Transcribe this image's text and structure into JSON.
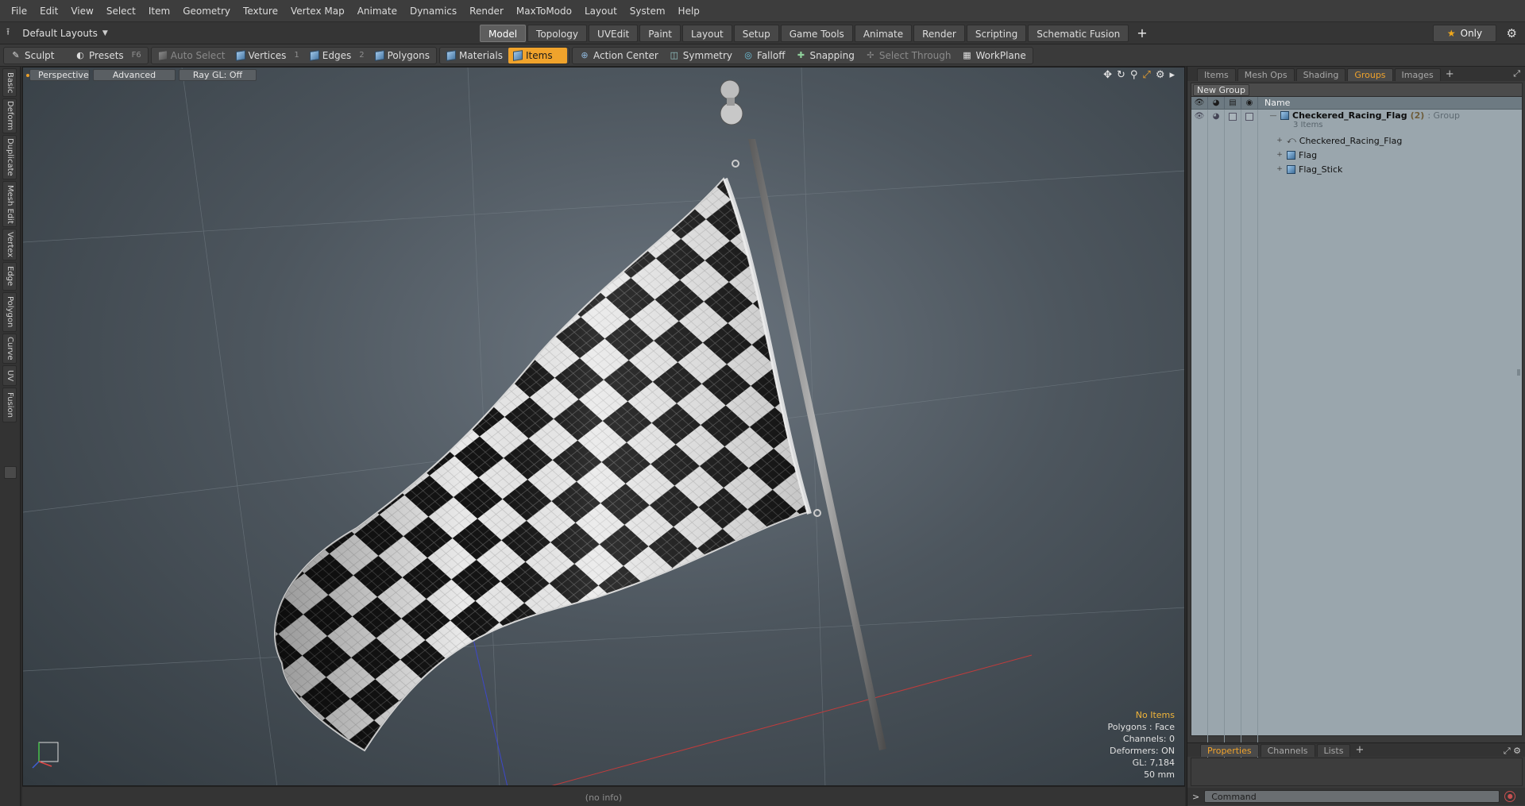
{
  "menubar": {
    "items": [
      "File",
      "Edit",
      "View",
      "Select",
      "Item",
      "Geometry",
      "Texture",
      "Vertex Map",
      "Animate",
      "Dynamics",
      "Render",
      "MaxToModo",
      "Layout",
      "System",
      "Help"
    ]
  },
  "tabbar": {
    "layout_selector": "Default Layouts",
    "tabs": [
      "Model",
      "Topology",
      "UVEdit",
      "Paint",
      "Layout",
      "Setup",
      "Game Tools",
      "Animate",
      "Render",
      "Scripting",
      "Schematic Fusion"
    ],
    "active_tab": "Model",
    "add_tab": "+",
    "only_label": "Only"
  },
  "toolbar": {
    "sculpt": "Sculpt",
    "presets": "Presets",
    "presets_key": "F6",
    "auto_select": "Auto Select",
    "vertices": "Vertices",
    "vertices_key": "1",
    "edges": "Edges",
    "edges_key": "2",
    "polygons": "Polygons",
    "materials": "Materials",
    "items": "Items",
    "action_center": "Action Center",
    "symmetry": "Symmetry",
    "falloff": "Falloff",
    "snapping": "Snapping",
    "select_through": "Select Through",
    "workplane": "WorkPlane"
  },
  "left_tabs": [
    "Basic",
    "Deform",
    "Duplicate",
    "Mesh Edit",
    "Vertex",
    "Edge",
    "Polygon",
    "Curve",
    "UV",
    "Fusion"
  ],
  "viewport": {
    "view_mode": "Perspective",
    "shading": "Advanced",
    "raygl": "Ray GL: Off",
    "info": {
      "selection": "No Items",
      "polygons": "Polygons : Face",
      "channels": "Channels: 0",
      "deformers": "Deformers: ON",
      "gl": "GL: 7,184",
      "unit": "50 mm"
    }
  },
  "statusbar": {
    "text": "(no info)"
  },
  "right_panel": {
    "tabs": [
      "Items",
      "Mesh Ops",
      "Shading",
      "Groups",
      "Images"
    ],
    "active_tab": "Groups",
    "new_group": "New Group",
    "column_name": "Name",
    "tree": {
      "group_name": "Checkered_Racing_Flag",
      "group_count": "(2)",
      "group_type": ": Group",
      "group_sub": "3 Items",
      "children": [
        "Checkered_Racing_Flag",
        "Flag",
        "Flag_Stick"
      ]
    },
    "bottom_tabs": [
      "Properties",
      "Channels",
      "Lists"
    ],
    "bottom_active": "Properties",
    "command_placeholder": "Command"
  },
  "colors": {
    "accent": "#f0a32c",
    "viewport_bg": "#4d565e",
    "groups_bg": "#9aa6ad"
  },
  "icons": {
    "flag_render": "checkered-flag-mesh",
    "axis_gizmo": "axis-gizmo-icon"
  }
}
